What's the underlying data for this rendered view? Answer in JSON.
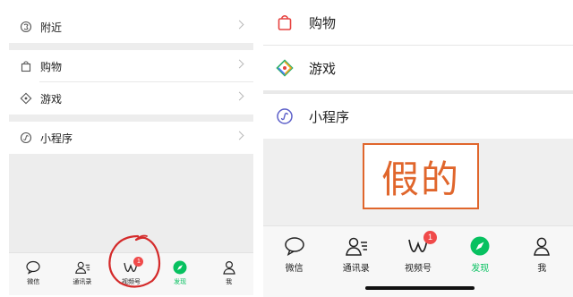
{
  "left_panel": {
    "items": [
      {
        "label": "附近",
        "icon": "nearby-icon"
      },
      {
        "label": "购物",
        "icon": "shopping-bag-icon"
      },
      {
        "label": "游戏",
        "icon": "game-icon"
      },
      {
        "label": "小程序",
        "icon": "mini-program-icon"
      }
    ],
    "tabs": [
      {
        "label": "微信",
        "icon": "chat-bubble-icon"
      },
      {
        "label": "通讯录",
        "icon": "contacts-icon"
      },
      {
        "label": "视频号",
        "icon": "channels-icon",
        "badge": "1"
      },
      {
        "label": "发现",
        "icon": "discover-compass-icon",
        "active": true
      },
      {
        "label": "我",
        "icon": "me-person-icon"
      }
    ]
  },
  "right_panel": {
    "items": [
      {
        "label": "购物",
        "icon": "shopping-bag-icon"
      },
      {
        "label": "游戏",
        "icon": "game-icon"
      },
      {
        "label": "小程序",
        "icon": "mini-program-icon"
      }
    ],
    "annotation": "假的",
    "tabs": [
      {
        "label": "微信",
        "icon": "chat-bubble-icon"
      },
      {
        "label": "通讯录",
        "icon": "contacts-icon"
      },
      {
        "label": "视频号",
        "icon": "channels-icon",
        "badge": "1"
      },
      {
        "label": "发现",
        "icon": "discover-compass-icon",
        "active": true
      },
      {
        "label": "我",
        "icon": "me-person-icon"
      }
    ]
  },
  "colors": {
    "accent_green": "#07c160",
    "badge_red": "#f04a4a",
    "annotation_orange": "#e0662c",
    "scribble_red": "#d42a2a"
  }
}
